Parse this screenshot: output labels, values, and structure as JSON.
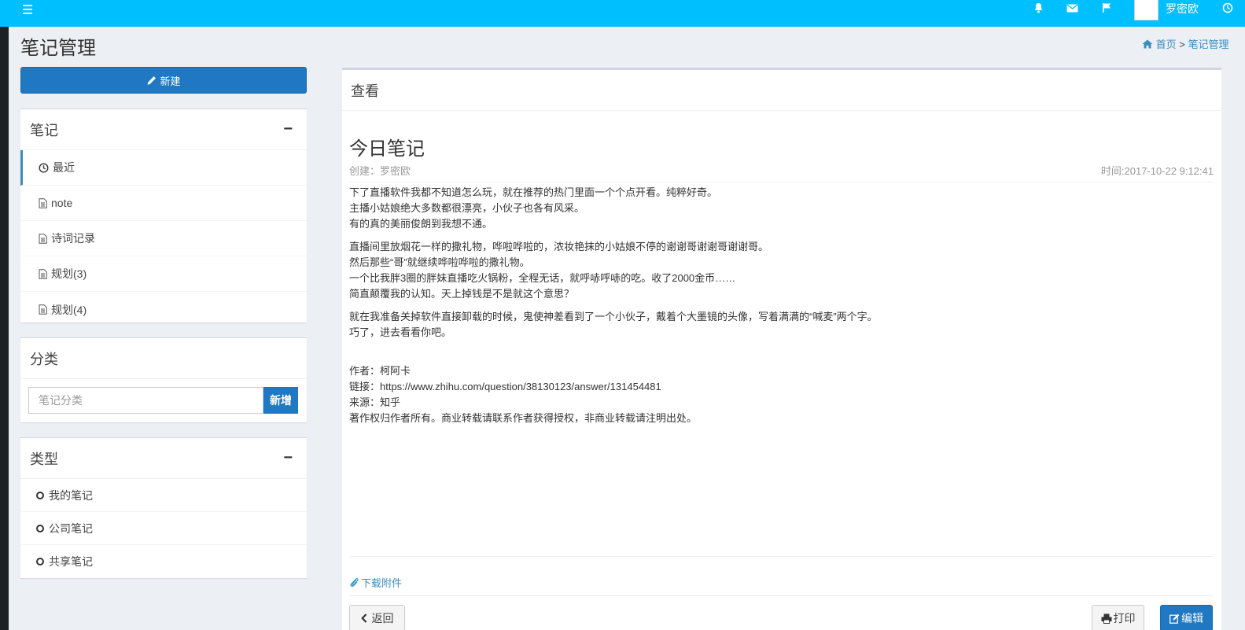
{
  "topbar": {
    "bg_color": "#00bfff",
    "icons": [
      "menu-icon",
      "bell-icon",
      "envelope-icon",
      "flag-icon",
      "clock-icon"
    ],
    "user_name": "罗密欧"
  },
  "page": {
    "title": "笔记管理",
    "breadcrumb": {
      "home": "首页",
      "separator": ">",
      "current": "笔记管理"
    }
  },
  "sidebar": {
    "new_button": "新建",
    "notes_box": {
      "title": "笔记",
      "collapse": "−",
      "items": [
        {
          "label": "最近",
          "icon": "clock-icon",
          "active": true
        },
        {
          "label": "note",
          "icon": "file-icon"
        },
        {
          "label": "诗词记录",
          "icon": "file-icon"
        },
        {
          "label": "规划(3)",
          "icon": "file-icon"
        },
        {
          "label": "规划(4)",
          "icon": "file-icon"
        }
      ]
    },
    "category_box": {
      "title": "分类",
      "input_placeholder": "笔记分类",
      "add_button": "新增"
    },
    "type_box": {
      "title": "类型",
      "collapse": "−",
      "items": [
        {
          "label": "我的笔记",
          "icon": "circle-icon"
        },
        {
          "label": "公司笔记",
          "icon": "circle-icon"
        },
        {
          "label": "共享笔记",
          "icon": "circle-icon"
        }
      ]
    }
  },
  "main": {
    "header": "查看",
    "note_title": "今日笔记",
    "creator": "创建：罗密欧",
    "time": "时间:2017-10-22 9:12:41",
    "paragraphs": [
      [
        "下了直播软件我都不知道怎么玩，就在推荐的热门里面一个个点开看。纯粹好奇。",
        "主播小姑娘绝大多数都很漂亮，小伙子也各有风采。",
        "有的真的美丽俊朗到我想不通。"
      ],
      [
        "直播间里放烟花一样的撒礼物，哗啦哗啦的，浓妆艳抹的小姑娘不停的谢谢哥谢谢哥谢谢哥。",
        "然后那些“哥”就继续哗啦哗啦的撒礼物。",
        "一个比我胖3圈的胖妹直播吃火锅粉，全程无话，就呼哧呼哧的吃。收了2000金币……",
        "简直颠覆我的认知。天上掉钱是不是就这个意思？"
      ],
      [
        "就在我准备关掉软件直接卸载的时候，鬼使神差看到了一个小伙子，戴着个大墨镜的头像，写着满满的“喊麦”两个字。",
        "巧了，进去看看你吧。"
      ],
      [
        "作者：柯阿卡",
        "链接：https://www.zhihu.com/question/38130123/answer/131454481",
        "来源：知乎",
        "著作权归作者所有。商业转载请联系作者获得授权，非商业转载请注明出处。"
      ]
    ],
    "attachment": "下载附件",
    "back_button": "返回",
    "print_button": "打印",
    "edit_button": "编辑"
  }
}
